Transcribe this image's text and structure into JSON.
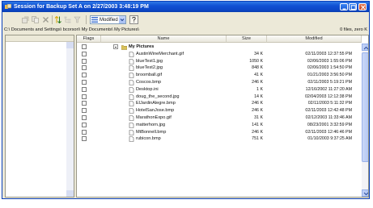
{
  "window": {
    "title": "Session for Backup Set A on 2/27/2003 3:48:19 PM"
  },
  "toolbar": {
    "view_select_value": "Modified",
    "help_label": "?"
  },
  "pathbar": {
    "path": "C:\\ Documents and Settings\\ bcorsori\\ My Documents\\ My Pictures\\",
    "stats": "0 files, zero K"
  },
  "columns": {
    "flags": "Flags",
    "name": "Name",
    "size": "Size",
    "modified": "Modified"
  },
  "folder": {
    "name": "My Pictures"
  },
  "files": [
    {
      "name": "AustinWineMerchant.gif",
      "size": "34 K",
      "modified": "02/11/2003  12:37:55 PM"
    },
    {
      "name": "blueTest1.jpg",
      "size": "1050 K",
      "modified": "02/06/2003   1:55:06 PM"
    },
    {
      "name": "blueTest2.jpg",
      "size": "848 K",
      "modified": "02/06/2003   1:54:50 PM"
    },
    {
      "name": "broomball.gif",
      "size": "41 K",
      "modified": "01/21/2003   3:56:50 PM"
    },
    {
      "name": "Coscos.bmp",
      "size": "246 K",
      "modified": "02/11/2003   5:19:21 PM"
    },
    {
      "name": "Desktop.ini",
      "size": "1 K",
      "modified": "12/16/2002  11:27:20 AM"
    },
    {
      "name": "doug_the_second.jpg",
      "size": "14 K",
      "modified": "02/04/2003  12:12:38 PM"
    },
    {
      "name": "ElJardinAlegre.bmp",
      "size": "246 K",
      "modified": "02/11/2003   5:11:32 PM"
    },
    {
      "name": "HotelSanJose.bmp",
      "size": "246 K",
      "modified": "02/11/2003  12:42:48 PM"
    },
    {
      "name": "MarathonExpo.gif",
      "size": "31 K",
      "modified": "02/12/2003  11:33:46 AM"
    },
    {
      "name": "matterhorn.jpg",
      "size": "141 K",
      "modified": "08/23/2001   3:32:59 PM"
    },
    {
      "name": "MtBonnell.bmp",
      "size": "246 K",
      "modified": "02/11/2003  12:46:46 PM"
    },
    {
      "name": "rubicon.bmp",
      "size": "751 K",
      "modified": "01/10/2003   9:37:25 AM"
    }
  ],
  "colors": {
    "titlebar": "#0c46c6",
    "window_bg": "#ece9d8",
    "folder": "#d8c15a"
  }
}
